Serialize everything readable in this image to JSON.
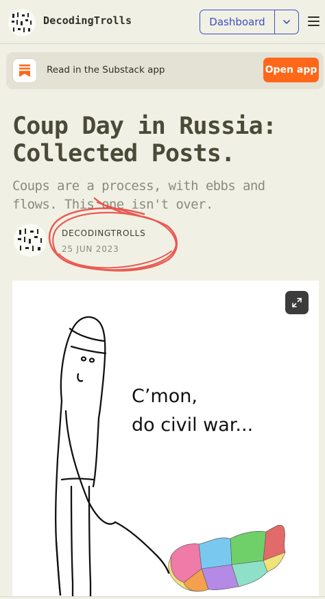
{
  "header": {
    "publication_name": "DecodingTrolls",
    "dashboard_label": "Dashboard",
    "logo_icon": "scribble-pattern-logo",
    "dropdown_icon": "chevron-down-icon",
    "menu_icon": "hamburger-menu-icon"
  },
  "banner": {
    "text": "Read in the Substack app",
    "button_label": "Open app",
    "icon": "substack-bookmark-icon",
    "accent_color": "#ff6719"
  },
  "article": {
    "title": "Coup Day in Russia: Collected Posts.",
    "subtitle": "Coups are a process, with ebbs and flows. This one isn't over.",
    "author": "DECODINGTROLLS",
    "date": "25 JUN 2023"
  },
  "image": {
    "caption_line1": "C’mon,",
    "caption_line2": "do civil war...",
    "expand_icon": "expand-icon",
    "description_icon": "stick-figure-poking-russia-map"
  },
  "colors": {
    "background": "#f1f0e4",
    "link_blue": "#3b4fc4",
    "annotation_red": "#e8413a"
  }
}
